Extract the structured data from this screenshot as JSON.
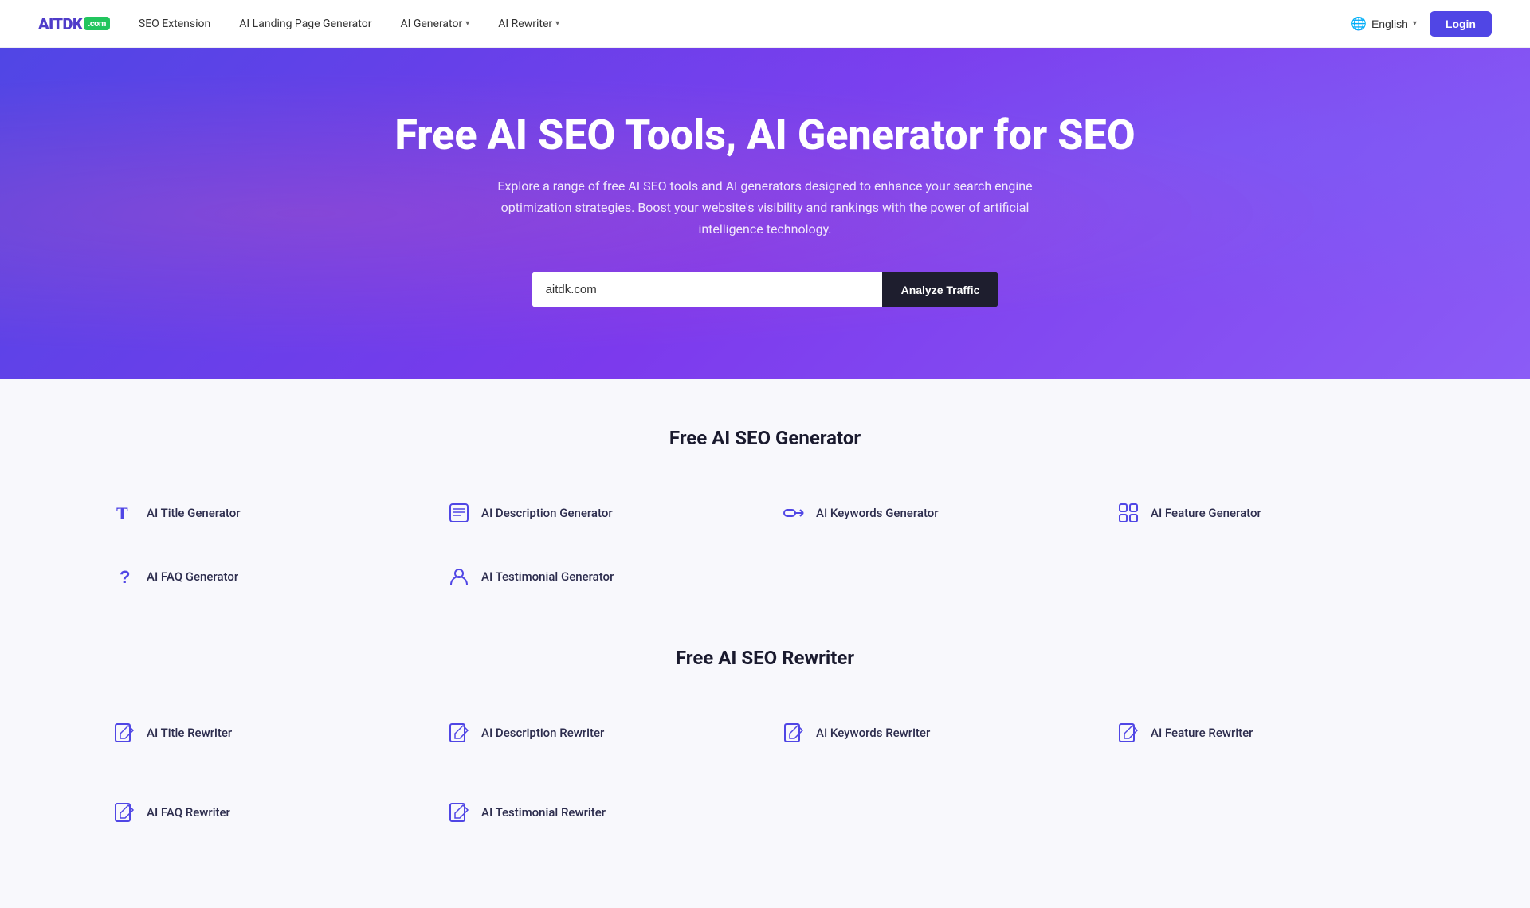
{
  "brand": {
    "name": "AITDK",
    "badge": ".com"
  },
  "nav": {
    "links": [
      {
        "id": "seo-extension",
        "label": "SEO Extension",
        "hasDropdown": false
      },
      {
        "id": "ai-landing-page",
        "label": "AI Landing Page Generator",
        "hasDropdown": false
      },
      {
        "id": "ai-generator",
        "label": "AI Generator",
        "hasDropdown": true
      },
      {
        "id": "ai-rewriter",
        "label": "AI Rewriter",
        "hasDropdown": true
      }
    ],
    "language": "English",
    "loginLabel": "Login"
  },
  "hero": {
    "title": "Free AI SEO Tools, AI Generator for SEO",
    "subtitle": "Explore a range of free AI SEO tools and AI generators designed to enhance your search engine optimization strategies. Boost your website's visibility and rankings with the power of artificial intelligence technology.",
    "inputValue": "aitdk.com",
    "inputPlaceholder": "aitdk.com",
    "analyzeButtonLabel": "Analyze Traffic"
  },
  "sections": [
    {
      "id": "generator",
      "title": "Free AI SEO Generator",
      "tools": [
        {
          "id": "ai-title-gen",
          "name": "AI Title Generator",
          "icon": "T"
        },
        {
          "id": "ai-desc-gen",
          "name": "AI Description Generator",
          "icon": "doc"
        },
        {
          "id": "ai-keywords-gen",
          "name": "AI Keywords Generator",
          "icon": "key"
        },
        {
          "id": "ai-feature-gen",
          "name": "AI Feature Generator",
          "icon": "grid"
        },
        {
          "id": "ai-faq-gen",
          "name": "AI FAQ Generator",
          "icon": "question"
        },
        {
          "id": "ai-testimonial-gen",
          "name": "AI Testimonial Generator",
          "icon": "person"
        }
      ]
    },
    {
      "id": "rewriter",
      "title": "Free AI SEO Rewriter",
      "tools": [
        {
          "id": "ai-title-rew",
          "name": "AI Title Rewriter",
          "icon": "edit"
        },
        {
          "id": "ai-desc-rew",
          "name": "AI Description Rewriter",
          "icon": "edit"
        },
        {
          "id": "ai-keywords-rew",
          "name": "AI Keywords Rewriter",
          "icon": "edit"
        },
        {
          "id": "ai-feature-rew",
          "name": "AI Feature Rewriter",
          "icon": "edit"
        }
      ]
    }
  ]
}
